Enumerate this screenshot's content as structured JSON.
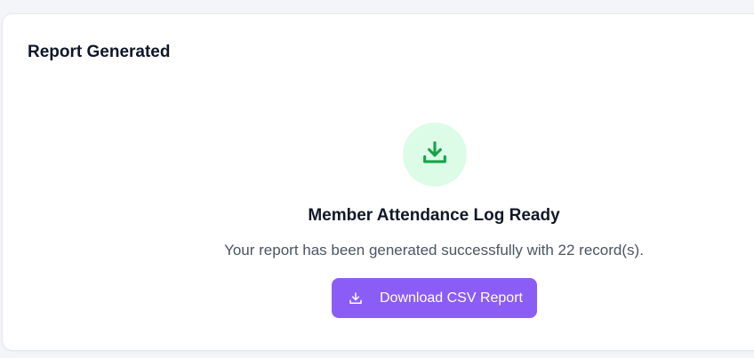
{
  "card": {
    "title": "Report Generated"
  },
  "status": {
    "icon": "download-icon",
    "headline": "Member Attendance Log Ready",
    "message": "Your report has been generated successfully with 22 record(s)."
  },
  "download_button": {
    "label": "Download CSV Report",
    "icon": "download-icon"
  },
  "colors": {
    "accent": "#8b5cf6",
    "success": "#16a34a",
    "success_bg": "#dcfce7"
  }
}
